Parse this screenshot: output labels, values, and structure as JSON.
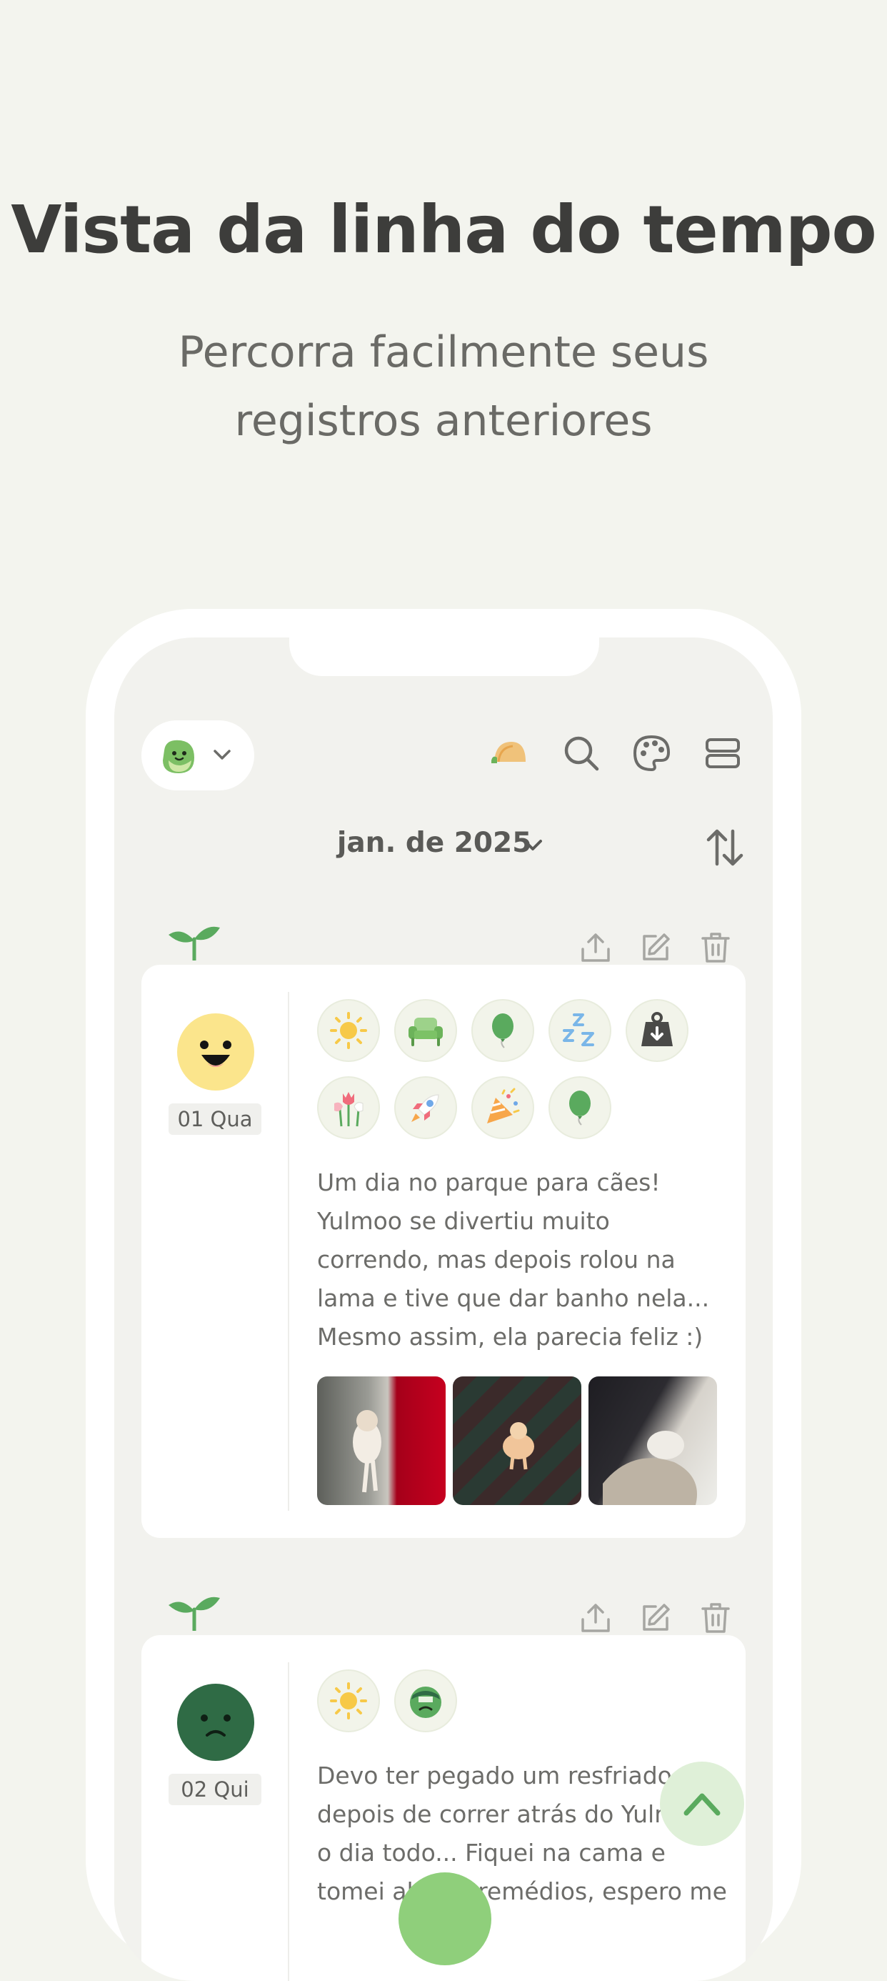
{
  "hero": {
    "title": "Vista da linha do tempo",
    "subtitle": "Percorra facilmente seus registros anteriores"
  },
  "toolbar": {
    "profile_icon": "green-blob-face-icon",
    "icons": [
      "taco-icon",
      "search-icon",
      "palette-icon",
      "list-view-icon"
    ]
  },
  "month_selector": {
    "label": "jan. de 2025"
  },
  "entries": [
    {
      "date": "01 Qua",
      "mood": "happy-yellow-face-icon",
      "activities": [
        "sun-icon",
        "sofa-icon",
        "balloon-icon",
        "sleep-zzz-icon",
        "weight-icon",
        "tulips-icon",
        "rocket-icon",
        "party-popper-icon",
        "balloon-icon"
      ],
      "note": "Um dia no parque para cães!\nYulmoo se divertiu muito\ncorrendo, mas depois rolou na\nlama e tive que dar banho nela...\nMesmo assim, ela parecia feliz :)",
      "photos": [
        "dog-photo-1",
        "dog-photo-2",
        "dog-photo-3"
      ]
    },
    {
      "date": "02 Qui",
      "mood": "sad-green-face-icon",
      "activities": [
        "sun-icon",
        "sick-face-icon"
      ],
      "note": "Devo ter pegado um resfriado\ndepois de correr atrás do Yulm\no dia todo... Fiquei na cama e\ntomei alguns remédios, espero me"
    }
  ],
  "colors": {
    "background": "#f3f4ee",
    "accent_green": "#5aaa5e",
    "fab": "#dff0d8"
  }
}
